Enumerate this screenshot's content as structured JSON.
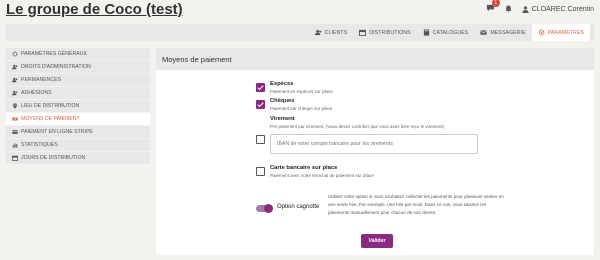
{
  "header": {
    "title": "Le groupe de Coco (test)",
    "notification_count": "1",
    "user_name": "CLOAREC Corentin"
  },
  "nav": {
    "items": [
      {
        "label": "CLIENTS",
        "icon": "users-icon"
      },
      {
        "label": "DISTRIBUTIONS",
        "icon": "calendar-icon"
      },
      {
        "label": "CATALOGUES",
        "icon": "book-icon"
      },
      {
        "label": "MESSAGERIE",
        "icon": "envelope-icon"
      },
      {
        "label": "PARAMÈTRES",
        "icon": "gear-icon",
        "active": true
      }
    ]
  },
  "sidebar": {
    "items": [
      {
        "label": "PARAMÈTRES GÉNÉRAUX",
        "icon": "gear-icon"
      },
      {
        "label": "DROITS D'ADMINISTRATION",
        "icon": "users-icon"
      },
      {
        "label": "PERMANENCES",
        "icon": "users-icon"
      },
      {
        "label": "ADHÉSIONS",
        "icon": "users-icon"
      },
      {
        "label": "LIEU DE DISTRIBUTION",
        "icon": "map-pin-icon"
      },
      {
        "label": "MOYENS DE PAIEMENT",
        "icon": "money-icon",
        "active": true
      },
      {
        "label": "PAIEMENT EN LIGNE STRIPE",
        "icon": "card-icon"
      },
      {
        "label": "STATISTIQUES",
        "icon": "chart-icon"
      },
      {
        "label": "JOURS DE DISTRIBUTION",
        "icon": "calendar-icon"
      }
    ]
  },
  "panel": {
    "title": "Moyens de paiement",
    "methods": [
      {
        "title": "Espèces",
        "help": "Paiement en espèces sur place",
        "checked": true
      },
      {
        "title": "Chèques",
        "help": "Paiement par chèque sur place",
        "checked": true
      },
      {
        "title": "Virement",
        "help": "Pré-paiement par virement. (Vous devez contrôler que vous avez bien reçu le virement)",
        "checked": false,
        "iban_placeholder": "IBAN de votre compte bancaire pour les virements"
      },
      {
        "title": "Carte bancaire sur place",
        "help": "Paiement avec votre terminal de paiement sur place",
        "checked": false
      }
    ],
    "cagnotte": {
      "label": "Option cagnotte",
      "enabled": true,
      "description": "Utilisez cette option si vous souhaitez collecter les paiements pour plusieurs ventes en une seule fois. Par exemple, une fois par mois. Dans ce cas, vous saisirez les paiements manuellement pour chacun de vos clients."
    },
    "submit_label": "Valider"
  },
  "colors": {
    "accent": "#e0663a",
    "primary": "#8a2a82",
    "badge": "#e0443a"
  }
}
